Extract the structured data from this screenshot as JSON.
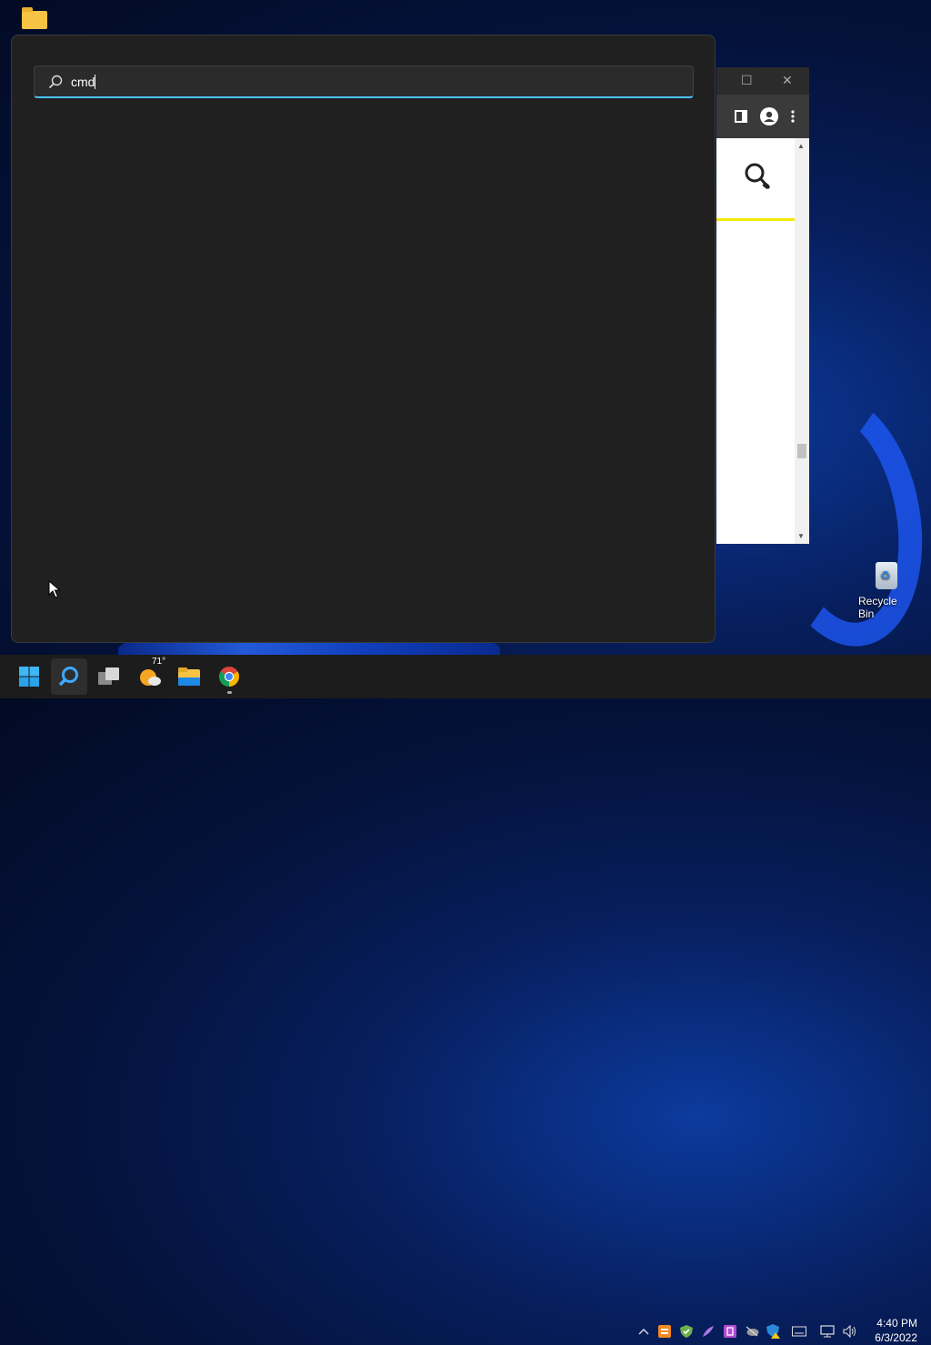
{
  "desktop": {
    "recycle_bin_label": "Recycle Bin",
    "folder_icon": "folder-icon"
  },
  "search": {
    "query": "cmd",
    "icon": "search-icon"
  },
  "taskbar": {
    "weather_temp": "71°",
    "apps": [
      "start",
      "search",
      "task-view",
      "weather",
      "file-explorer",
      "chrome"
    ]
  },
  "clock": {
    "time": "4:40 PM",
    "date": "6/3/2022"
  },
  "colors": {
    "accent": "#4cc2ff",
    "panel_bg": "#202020",
    "taskbar_bg": "#1c1c1c"
  }
}
